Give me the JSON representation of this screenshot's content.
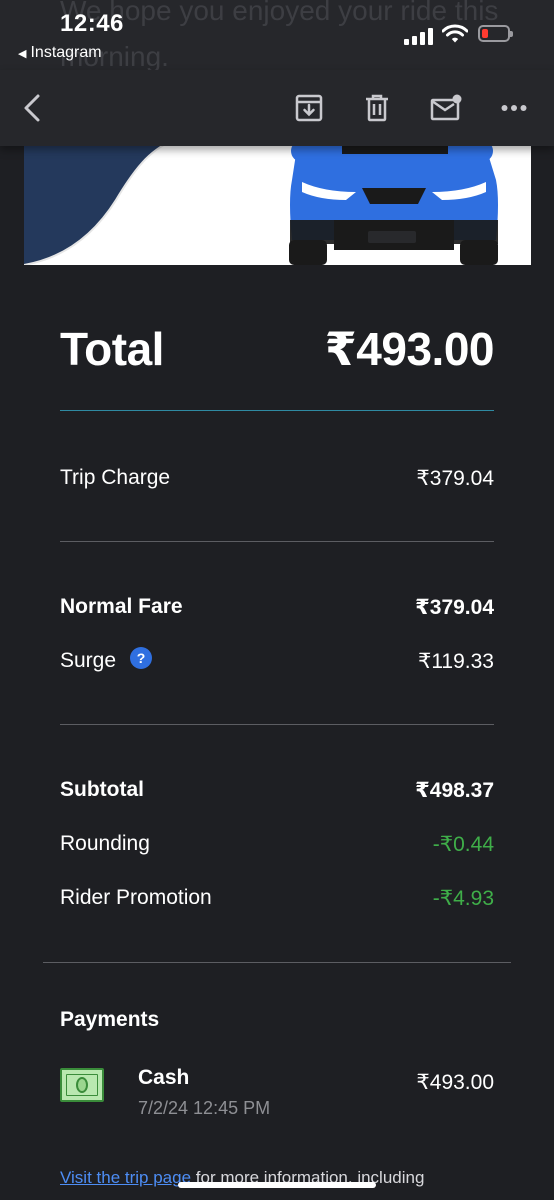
{
  "status_bar": {
    "time": "12:46",
    "back_app": "Instagram",
    "ghost_text": "We hope you enjoyed your ride this morning."
  },
  "toolbar": {
    "icons": [
      "back-chevron-icon",
      "archive-icon",
      "trash-icon",
      "mail-unread-icon",
      "more-icon"
    ]
  },
  "receipt": {
    "total_label": "Total",
    "total_value": "₹493.00",
    "trip_charge": {
      "label": "Trip Charge",
      "value": "₹379.04"
    },
    "normal_fare": {
      "label": "Normal Fare",
      "value": "₹379.04"
    },
    "surge": {
      "label": "Surge",
      "help": "?",
      "value": "₹119.33"
    },
    "subtotal": {
      "label": "Subtotal",
      "value": "₹498.37"
    },
    "rounding": {
      "label": "Rounding",
      "value": "-₹0.44"
    },
    "rider_promotion": {
      "label": "Rider Promotion",
      "value": "-₹4.93"
    }
  },
  "payments": {
    "title": "Payments",
    "method": "Cash",
    "datetime": "7/2/24 12:45 PM",
    "amount": "₹493.00"
  },
  "footer": {
    "link_text": "Visit the trip page",
    "rest_text": " for more information, including"
  },
  "colors": {
    "background": "#1e1f23",
    "discount_green": "#3fae49",
    "link_blue": "#4d8df5",
    "car_blue": "#2f6fe0",
    "total_rule": "#2f8aa2"
  }
}
